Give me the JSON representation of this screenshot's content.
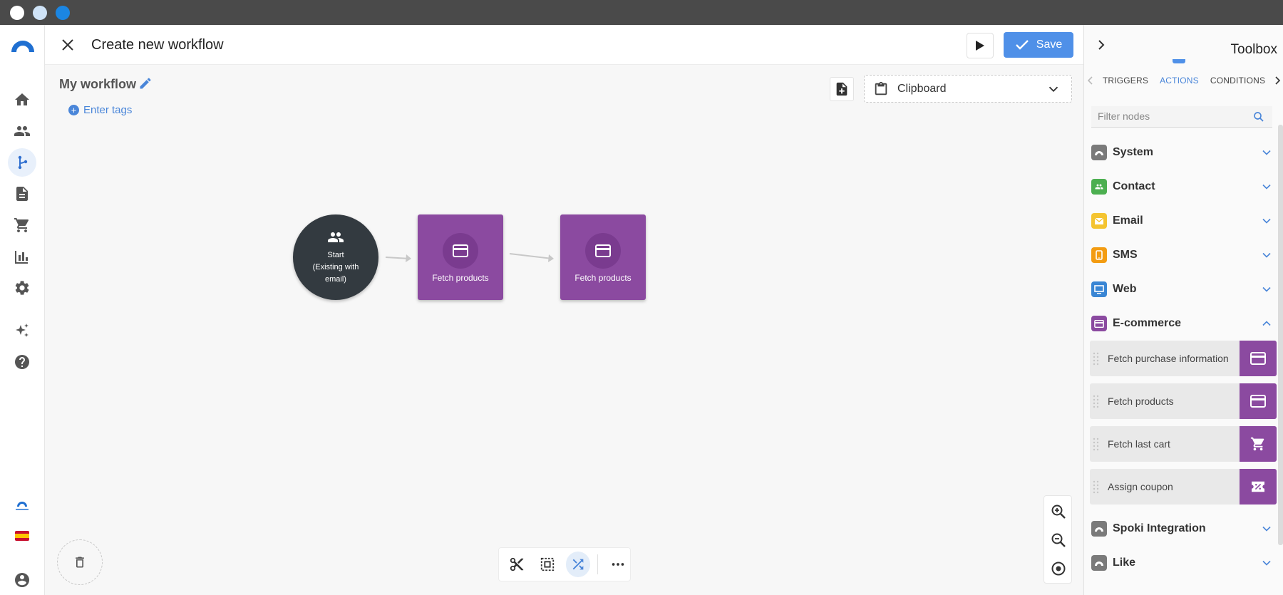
{
  "window": {
    "controls": [
      "close",
      "minimize",
      "maximize"
    ]
  },
  "header": {
    "title": "Create new workflow",
    "save_label": "Save"
  },
  "nav": {
    "items": [
      "home-icon",
      "people-icon",
      "workflow-icon",
      "document-icon",
      "cart-icon",
      "chart-icon",
      "settings-icon",
      "sparkle-icon",
      "help-icon"
    ],
    "active": "workflow-icon",
    "bottom": [
      "connectif-logo",
      "spain-flag",
      "account-icon"
    ]
  },
  "workflow": {
    "name": "My workflow",
    "tags_label": "Enter tags"
  },
  "clipboard": {
    "label": "Clipboard"
  },
  "nodes": {
    "start": {
      "line1": "Start",
      "line2": "(Existing with",
      "line3": "email)"
    },
    "node1": {
      "label": "Fetch products"
    },
    "node2": {
      "label": "Fetch products"
    }
  },
  "toolbox": {
    "title": "Toolbox",
    "tabs": [
      "TRIGGERS",
      "ACTIONS",
      "CONDITIONS"
    ],
    "active_tab": "ACTIONS",
    "filter_placeholder": "Filter nodes",
    "categories": [
      {
        "label": "System",
        "color": "#7a7a7a",
        "expanded": false
      },
      {
        "label": "Contact",
        "color": "#4caf50",
        "expanded": false
      },
      {
        "label": "Email",
        "color": "#f4c430",
        "expanded": false
      },
      {
        "label": "SMS",
        "color": "#f39c12",
        "expanded": false
      },
      {
        "label": "Web",
        "color": "#3a86d4",
        "expanded": false
      },
      {
        "label": "E-commerce",
        "color": "#8b4aa0",
        "expanded": true
      },
      {
        "label": "Spoki Integration",
        "color": "#7a7a7a",
        "expanded": false
      },
      {
        "label": "Like",
        "color": "#7a7a7a",
        "expanded": false
      }
    ],
    "ecommerce_items": [
      {
        "label": "Fetch purchase information",
        "icon": "card-icon"
      },
      {
        "label": "Fetch products",
        "icon": "card-icon"
      },
      {
        "label": "Fetch last cart",
        "icon": "cart-icon"
      },
      {
        "label": "Assign coupon",
        "icon": "coupon-icon"
      }
    ]
  },
  "colors": {
    "accent": "#4f90e8",
    "node_purple": "#8b4aa0",
    "start_node": "#333a40"
  }
}
